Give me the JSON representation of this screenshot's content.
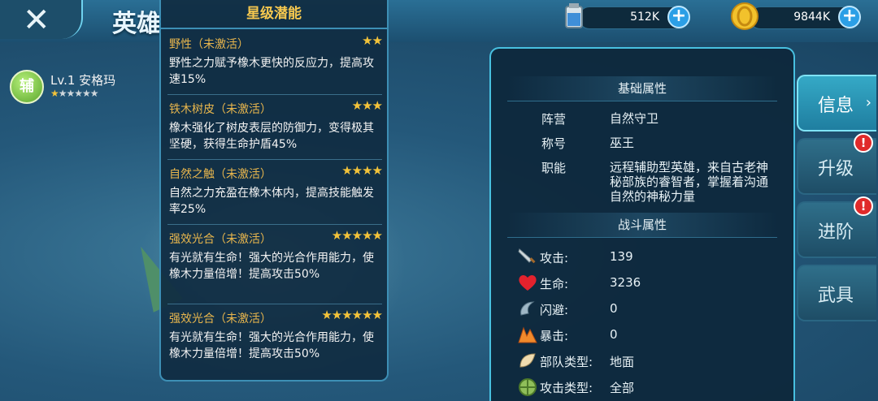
{
  "header": {
    "title": "英雄",
    "close_glyph": "✕"
  },
  "resources": [
    {
      "name": "potion",
      "icon": "potion-icon",
      "value": "512K"
    },
    {
      "name": "gold",
      "icon": "gold-coin-icon",
      "value": "9844K"
    }
  ],
  "hero": {
    "role_badge": "辅",
    "level_name": "Lv.1 安格玛",
    "stars_total": 6,
    "stars_filled": 1
  },
  "star_panel": {
    "title": "星级潜能",
    "skills": [
      {
        "name": "野性（未激活）",
        "stars": "★★",
        "desc": "野性之力赋予橡木更快的反应力，提高攻速15%"
      },
      {
        "name": "铁木树皮（未激活）",
        "stars": "★★★",
        "desc": "橡木强化了树皮表层的防御力，变得极其坚硬，获得生命护盾45%"
      },
      {
        "name": "自然之触（未激活）",
        "stars": "★★★★",
        "desc": "自然之力充盈在橡木体内，提高技能触发率25%"
      },
      {
        "name": "强效光合（未激活）",
        "stars": "★★★★★",
        "desc": "有光就有生命！强大的光合作用能力，使橡木力量倍增！提高攻击50%"
      },
      {
        "name": "强效光合（未激活）",
        "stars": "★★★★★★",
        "desc": "有光就有生命！强大的光合作用能力，使橡木力量倍增！提高攻击50%"
      }
    ]
  },
  "attributes": {
    "basic_title": "基础属性",
    "basic": [
      {
        "label": "阵营",
        "value": "自然守卫"
      },
      {
        "label": "称号",
        "value": "巫王"
      },
      {
        "label": "职能",
        "value": "远程辅助型英雄，来自古老神秘部族的睿智者，掌握着沟通自然的神秘力量"
      }
    ],
    "combat_title": "战斗属性",
    "combat": [
      {
        "icon": "sword-icon",
        "label": "攻击:",
        "value": "139"
      },
      {
        "icon": "heart-icon",
        "label": "生命:",
        "value": "3236"
      },
      {
        "icon": "dodge-icon",
        "label": "闪避:",
        "value": "0"
      },
      {
        "icon": "critical-icon",
        "label": "暴击:",
        "value": "0"
      },
      {
        "icon": "unit-type-icon",
        "label": "部队类型:",
        "value": "地面"
      },
      {
        "icon": "attack-type-icon",
        "label": "攻击类型:",
        "value": "全部"
      }
    ]
  },
  "tabs": [
    {
      "label": "信息",
      "active": true
    },
    {
      "label": "升级",
      "alert": "!"
    },
    {
      "label": "进阶",
      "alert": "!"
    },
    {
      "label": "武具"
    }
  ],
  "colors": {
    "accent": "#48c0e0",
    "skill_name": "#e8b64d",
    "star": "#f3c33a",
    "alert": "#e02a2a"
  }
}
